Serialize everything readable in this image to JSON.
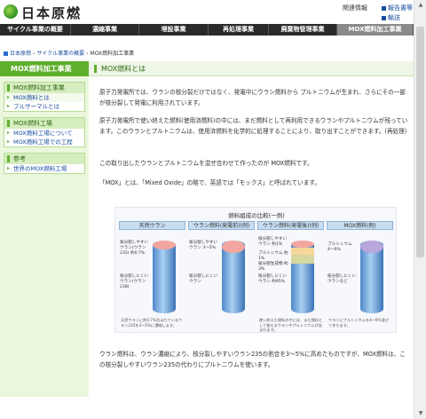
{
  "header": {
    "logo_text": "日本原燃",
    "links": {
      "related": "関連情報",
      "reports": "報告書等",
      "press": "輸送"
    }
  },
  "nav": {
    "items": [
      {
        "label": "サイクル事業の概要",
        "width": 80
      },
      {
        "label": "濃縮事業",
        "width": 77
      },
      {
        "label": "埋設事業",
        "width": 78
      },
      {
        "label": "再処理事業",
        "width": 68
      },
      {
        "label": "廃棄物管理事業",
        "width": 77
      },
      {
        "label": "MOX燃料加工事業",
        "width": 86
      }
    ]
  },
  "breadcrumb": {
    "home": "日本原燃",
    "level1": "サイクル事業の概要",
    "level2": "MOX燃料加工事業"
  },
  "sidebar": {
    "head": "MOX燃料加工事業",
    "boxes": [
      {
        "title": "MOX燃料加工事業",
        "items": [
          "MOX燃料とは",
          "プルサーマルとは"
        ]
      },
      {
        "title": "MOX燃料工場",
        "items": [
          "MOX燃料工場について",
          "MOX燃料工場での工程"
        ]
      },
      {
        "title": "参考",
        "items": [
          "世界のMOX燃料工場"
        ]
      }
    ]
  },
  "content": {
    "title": "MOX燃料とは",
    "para1": "原子力発電所では、ウランの核分裂だけではなく、発電中にウラン燃料から プルトニウムが生まれ、さらにその一部が核分裂して発電に利用されています。",
    "para2": "原子力発電所で使い終えた燃料(使用済燃料)の中には、まだ燃料として再利用できるウランやプルトニウムが残っています。このウランとプルトニウムは、使用済燃料を化学的に処理することにより、取り出すことができます。(再処理)",
    "para3": "この取り出したウランとプルトニウムを混ぜ合わせて作ったのが MOX燃料です。",
    "para4": "「MOX」とは、「Mixed Oxide」の略で、英語では「モックス」と呼ばれています。",
    "para5": "ウラン燃料は、ウラン濃縮により、核分裂しやすいウラン235の割合を3〜5%に高めたものですが、MOX燃料は、この核分裂しやすいウラン235の代わりにプルトニウムを使います。"
  },
  "figure": {
    "title": "燃料組成の比較(一例)",
    "columns": [
      {
        "header": "天然ウラン",
        "labels": [
          "核分裂しやすいウラン(ウラン235) 約0.7%",
          "核分裂しにくいウラン(ウラン238)"
        ],
        "note": "天然ウランに約0.7%含まれているウラン235を3〜5%に濃縮します。",
        "top_color": "#f3a6a0"
      },
      {
        "header": "ウラン燃料(発電前)(例)",
        "labels": [
          "核分裂しやすいウラン 3〜5%",
          "核分裂しにくいウラン"
        ],
        "note": "",
        "top_color": "#f3a6a0"
      },
      {
        "header": "ウラン燃料(発電後)(例)",
        "labels": [
          "核分裂しやすいウラン 約1%",
          "プルトニウム 約1%",
          "核分裂生成物 約3%",
          "核分裂しにくいウラン 約95%"
        ],
        "note": "使い終えた燃料の中には、まだ燃料として使えるウランやプルトニウムが含まれます。",
        "top_color": "#f6d79a"
      },
      {
        "header": "MOX燃料(例)",
        "labels": [
          "プルトニウム 4〜9%",
          "核分裂しにくいウランなど"
        ],
        "note": "ウランにプルトニウムを4〜9%混ぜて作ります。",
        "top_color": "#b9a6dc"
      }
    ]
  }
}
